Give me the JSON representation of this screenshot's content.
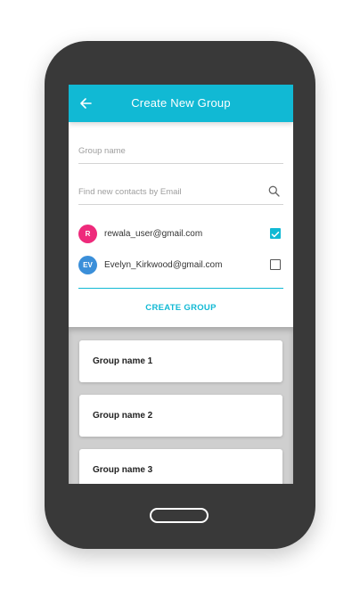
{
  "appbar": {
    "title": "Create New Group",
    "back_icon": "arrow-left-icon"
  },
  "form": {
    "group_name_placeholder": "Group name",
    "search_placeholder": "Find new contacts by Email",
    "search_icon": "search-icon"
  },
  "contacts": [
    {
      "initials": "R",
      "email": "rewala_user@gmail.com",
      "checked": true,
      "avatar_color": "#ee2a7b"
    },
    {
      "initials": "EV",
      "email": "Evelyn_Kirkwood@gmail.com",
      "checked": false,
      "avatar_color": "#3b8fd9"
    }
  ],
  "create_button_label": "CREATE GROUP",
  "groups": [
    {
      "name": "Group name 1"
    },
    {
      "name": "Group name 2"
    },
    {
      "name": "Group name 3"
    }
  ],
  "colors": {
    "accent": "#11b9d4",
    "phone_body": "#393939",
    "list_background": "#cfcfcf"
  }
}
